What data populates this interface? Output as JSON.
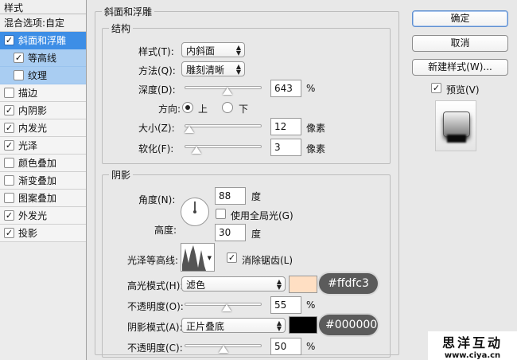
{
  "left_panel": {
    "header": "样式",
    "blend": "混合选项:自定",
    "items": [
      {
        "label": "斜面和浮雕",
        "checked": true
      },
      {
        "label": "等高线",
        "checked": true
      },
      {
        "label": "纹理",
        "checked": false
      },
      {
        "label": "描边",
        "checked": false
      },
      {
        "label": "内阴影",
        "checked": true
      },
      {
        "label": "内发光",
        "checked": true
      },
      {
        "label": "光泽",
        "checked": true
      },
      {
        "label": "颜色叠加",
        "checked": false
      },
      {
        "label": "渐变叠加",
        "checked": false
      },
      {
        "label": "图案叠加",
        "checked": false
      },
      {
        "label": "外发光",
        "checked": true
      },
      {
        "label": "投影",
        "checked": true
      }
    ]
  },
  "main": {
    "section_title": "斜面和浮雕",
    "structure": {
      "title": "结构",
      "style_label": "样式(T):",
      "style_value": "内斜面",
      "method_label": "方法(Q):",
      "method_value": "雕刻清晰",
      "depth_label": "深度(D):",
      "depth_value": "643",
      "depth_unit": "%",
      "direction_label": "方向:",
      "dir_up": "上",
      "dir_down": "下",
      "direction_selected": "上",
      "size_label": "大小(Z):",
      "size_value": "12",
      "size_unit": "像素",
      "soften_label": "软化(F):",
      "soften_value": "3",
      "soften_unit": "像素"
    },
    "shading": {
      "title": "阴影",
      "angle_label": "角度(N):",
      "angle_value": "88",
      "angle_unit": "度",
      "global_light_label": "使用全局光(G)",
      "global_light_checked": false,
      "altitude_label": "高度:",
      "altitude_value": "30",
      "altitude_unit": "度",
      "gloss_contour_label": "光泽等高线:",
      "antialias_label": "消除锯齿(L)",
      "antialias_checked": true,
      "highlight_mode_label": "高光模式(H):",
      "highlight_mode_value": "滤色",
      "highlight_color": "#ffdfc3",
      "highlight_color_text": "#ffdfc3",
      "highlight_opacity_label": "不透明度(O):",
      "highlight_opacity_value": "55",
      "highlight_opacity_unit": "%",
      "shadow_mode_label": "阴影模式(A):",
      "shadow_mode_value": "正片叠底",
      "shadow_color": "#000000",
      "shadow_color_text": "#000000",
      "shadow_opacity_label": "不透明度(C):",
      "shadow_opacity_value": "50",
      "shadow_opacity_unit": "%"
    }
  },
  "right": {
    "ok": "确定",
    "cancel": "取消",
    "new_style": "新建样式(W)...",
    "preview_label": "预览(V)",
    "preview_checked": true
  },
  "watermark": {
    "title": "思洋互动",
    "url": "www.ciya.cn"
  },
  "sliders": {
    "depth_fraction": 0.56,
    "size_fraction": 0.06,
    "soften_fraction": 0.15,
    "highlight_opacity_fraction": 0.55,
    "shadow_opacity_fraction": 0.5
  }
}
